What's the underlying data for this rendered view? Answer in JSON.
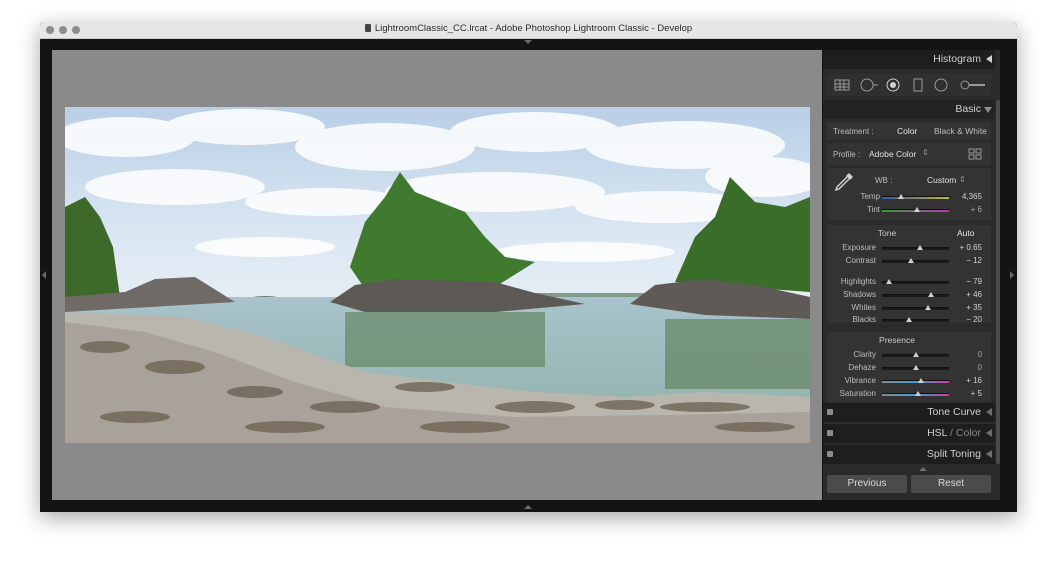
{
  "window": {
    "title": "LightroomClassic_CC.lrcat - Adobe Photoshop Lightroom Classic - Develop"
  },
  "panel": {
    "histogram": {
      "label": "Histogram"
    },
    "basic": {
      "label": "Basic",
      "treatment": {
        "label": "Treatment :",
        "color": "Color",
        "bw": "Black & White"
      },
      "profile": {
        "label": "Profile :",
        "value": "Adobe Color"
      },
      "wb": {
        "label": "WB :",
        "value": "Custom"
      },
      "temp": {
        "label": "Temp",
        "value": "4,365",
        "level": 0.28
      },
      "tint": {
        "label": "Tint",
        "value": "+ 6",
        "level": 0.52
      },
      "tone": {
        "label": "Tone",
        "auto": "Auto"
      },
      "exposure": {
        "label": "Exposure",
        "value": "+ 0.65",
        "level": 0.56
      },
      "contrast": {
        "label": "Contrast",
        "value": "− 12",
        "level": 0.44
      },
      "highlights": {
        "label": "Highlights",
        "value": "− 79",
        "level": 0.11
      },
      "shadows": {
        "label": "Shadows",
        "value": "+ 46",
        "level": 0.73
      },
      "whites": {
        "label": "Whites",
        "value": "+ 35",
        "level": 0.68
      },
      "blacks": {
        "label": "Blacks",
        "value": "− 20",
        "level": 0.4
      },
      "presence": {
        "label": "Presence"
      },
      "clarity": {
        "label": "Clarity",
        "value": "0",
        "level": 0.5
      },
      "dehaze": {
        "label": "Dehaze",
        "value": "0",
        "level": 0.5
      },
      "vibrance": {
        "label": "Vibrance",
        "value": "+ 16",
        "level": 0.58
      },
      "saturation": {
        "label": "Saturation",
        "value": "+ 5",
        "level": 0.53
      }
    },
    "tone_curve": {
      "label": "Tone Curve"
    },
    "hsl": {
      "label": "HSL",
      "sep": " / ",
      "color": "Color"
    },
    "split_toning": {
      "label": "Split Toning"
    },
    "buttons": {
      "previous": "Previous",
      "reset": "Reset"
    }
  },
  "colors": {
    "panel_bg": "#2b2b2b",
    "canvas_bg": "#8a8a8a",
    "header_bg": "#1e1e1e",
    "text": "#cfcfcf"
  }
}
